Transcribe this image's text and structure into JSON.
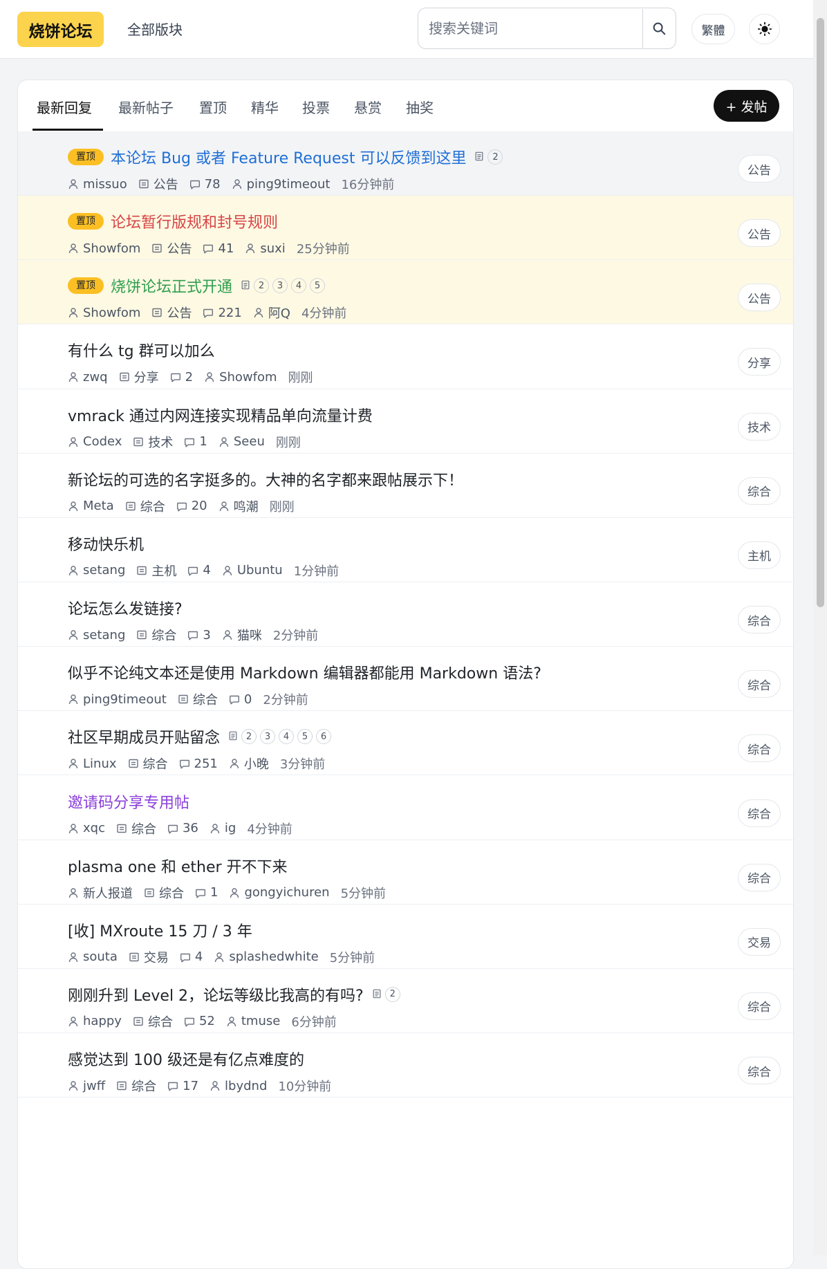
{
  "header": {
    "logo": "烧饼论坛",
    "all_boards": "全部版块",
    "search_placeholder": "搜索关键词",
    "trad_label": "繁體"
  },
  "tabs": [
    "最新回复",
    "最新帖子",
    "置顶",
    "精华",
    "投票",
    "悬赏",
    "抽奖"
  ],
  "post_button": "+ 发帖",
  "pin_label": "置顶",
  "posts": [
    {
      "title": "本论坛 Bug 或者 Feature Request 可以反馈到这里",
      "author": "missuo",
      "category": "公告",
      "replies": "78",
      "last_user": "ping9timeout",
      "time": "16分钟前",
      "tag": "公告",
      "pages": [
        "2"
      ]
    },
    {
      "title": "论坛暂行版规和封号规则",
      "author": "Showfom",
      "category": "公告",
      "replies": "41",
      "last_user": "suxi",
      "time": "25分钟前",
      "tag": "公告",
      "pages": []
    },
    {
      "title": "烧饼论坛正式开通",
      "author": "Showfom",
      "category": "公告",
      "replies": "221",
      "last_user": "阿Q",
      "time": "4分钟前",
      "tag": "公告",
      "pages": [
        "2",
        "3",
        "4",
        "5"
      ]
    },
    {
      "title": "有什么 tg 群可以加么",
      "author": "zwq",
      "category": "分享",
      "replies": "2",
      "last_user": "Showfom",
      "time": "刚刚",
      "tag": "分享",
      "pages": []
    },
    {
      "title": "vmrack 通过内网连接实现精品单向流量计费",
      "author": "Codex",
      "category": "技术",
      "replies": "1",
      "last_user": "Seeu",
      "time": "刚刚",
      "tag": "技术",
      "pages": []
    },
    {
      "title": "新论坛的可选的名字挺多的。大神的名字都来跟帖展示下！",
      "author": "Meta",
      "category": "综合",
      "replies": "20",
      "last_user": "鸣潮",
      "time": "刚刚",
      "tag": "综合",
      "pages": []
    },
    {
      "title": "移动快乐机",
      "author": "setang",
      "category": "主机",
      "replies": "4",
      "last_user": "Ubuntu",
      "time": "1分钟前",
      "tag": "主机",
      "pages": []
    },
    {
      "title": "论坛怎么发链接?",
      "author": "setang",
      "category": "综合",
      "replies": "3",
      "last_user": "猫咪",
      "time": "2分钟前",
      "tag": "综合",
      "pages": []
    },
    {
      "title": "似乎不论纯文本还是使用 Markdown 编辑器都能用 Markdown 语法?",
      "author": "ping9timeout",
      "category": "综合",
      "replies": "0",
      "last_user": "",
      "time": "2分钟前",
      "tag": "综合",
      "pages": []
    },
    {
      "title": "社区早期成员开贴留念",
      "author": "Linux",
      "category": "综合",
      "replies": "251",
      "last_user": "小晚",
      "time": "3分钟前",
      "tag": "综合",
      "pages": [
        "2",
        "3",
        "4",
        "5",
        "6"
      ]
    },
    {
      "title": "邀请码分享专用帖",
      "author": "xqc",
      "category": "综合",
      "replies": "36",
      "last_user": "ig",
      "time": "4分钟前",
      "tag": "综合",
      "pages": []
    },
    {
      "title": "plasma one 和 ether 开不下来",
      "author": "新人报道",
      "category": "综合",
      "replies": "1",
      "last_user": "gongyichuren",
      "time": "5分钟前",
      "tag": "综合",
      "pages": []
    },
    {
      "title": "[收] MXroute 15 刀 / 3 年",
      "author": "souta",
      "category": "交易",
      "replies": "4",
      "last_user": "splashedwhite",
      "time": "5分钟前",
      "tag": "交易",
      "pages": []
    },
    {
      "title": "刚刚升到 Level 2，论坛等级比我高的有吗?",
      "author": "happy",
      "category": "综合",
      "replies": "52",
      "last_user": "tmuse",
      "time": "6分钟前",
      "tag": "综合",
      "pages": [
        "2"
      ]
    },
    {
      "title": "感觉达到 100 级还是有亿点难度的",
      "author": "jwff",
      "category": "综合",
      "replies": "17",
      "last_user": "lbydnd",
      "time": "10分钟前",
      "tag": "综合",
      "pages": []
    }
  ]
}
